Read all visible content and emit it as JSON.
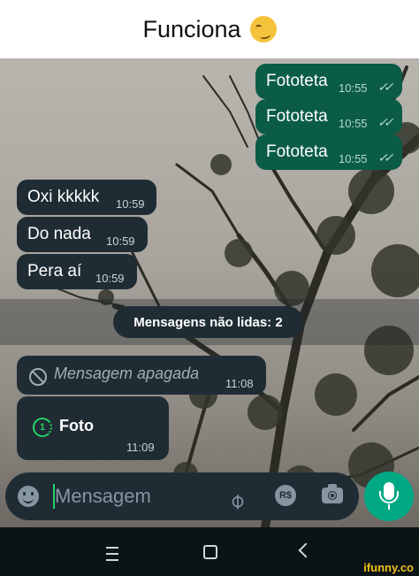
{
  "header": {
    "title": "Funciona"
  },
  "messages_out": [
    {
      "text": "Fototeta",
      "time": "10:55"
    },
    {
      "text": "Fototeta",
      "time": "10:55"
    },
    {
      "text": "Fototeta",
      "time": "10:55"
    }
  ],
  "messages_in": [
    {
      "text": "Oxi kkkkk",
      "time": "10:59"
    },
    {
      "text": "Do nada",
      "time": "10:59"
    },
    {
      "text": "Pera aí",
      "time": "10:59"
    }
  ],
  "unread": {
    "label": "Mensagens não lidas: 2"
  },
  "deleted_message": {
    "text": "Mensagem apagada",
    "time": "11:08"
  },
  "photo_message": {
    "label": "Foto",
    "view_once": "1",
    "time": "11:09"
  },
  "composer": {
    "placeholder": "Mensagem",
    "currency_label": "R$"
  },
  "watermark": "ifunny.co",
  "colors": {
    "outgoing": "#0b5c46",
    "incoming": "#1f2c34",
    "accent": "#00a884"
  }
}
